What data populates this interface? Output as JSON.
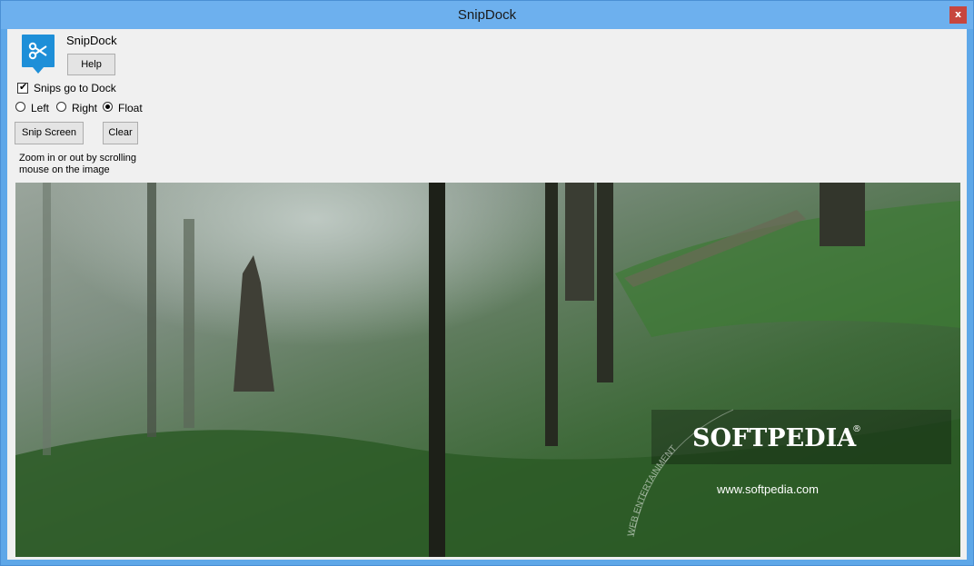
{
  "window": {
    "title": "SnipDock",
    "close_glyph": "x"
  },
  "app": {
    "name": "SnipDock",
    "icon": "scissors-icon",
    "help_label": "Help"
  },
  "options": {
    "snips_to_dock_label": "Snips go to Dock",
    "snips_to_dock_checked": true,
    "positions": [
      {
        "label": "Left",
        "selected": false
      },
      {
        "label": "Right",
        "selected": false
      },
      {
        "label": "Float",
        "selected": true
      }
    ]
  },
  "actions": {
    "snip_label": "Snip Screen",
    "clear_label": "Clear"
  },
  "hint": {
    "text": "Zoom in or out by scrolling mouse on the image"
  },
  "snip_image": {
    "brand": "SOFTPEDIA",
    "registered_mark": "®",
    "url": "www.softpedia.com",
    "arc_text": "WEB   ENTERTAINMENT"
  },
  "colors": {
    "titlebar": "#6db0ee",
    "close_button": "#c7463e",
    "icon_bg": "#1e8fd8"
  }
}
